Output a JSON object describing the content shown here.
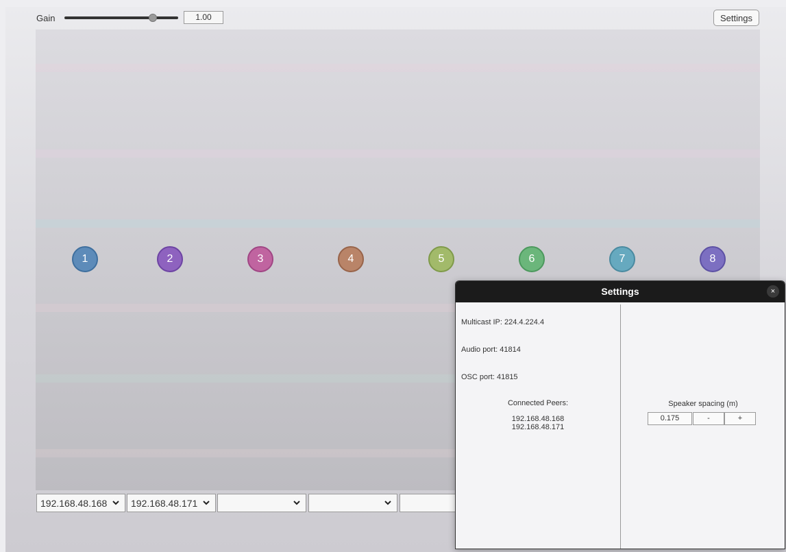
{
  "toolbar": {
    "gain_label": "Gain",
    "gain_value": "1.00",
    "gain_level": 0.78,
    "settings_label": "Settings"
  },
  "speakers": [
    {
      "label": "1",
      "color": "#5d8bb9",
      "border": "#3f6f9e"
    },
    {
      "label": "2",
      "color": "#8e62bf",
      "border": "#6d44a3"
    },
    {
      "label": "3",
      "color": "#c064a0",
      "border": "#a04684"
    },
    {
      "label": "4",
      "color": "#b98468",
      "border": "#98644a"
    },
    {
      "label": "5",
      "color": "#a2ba6a",
      "border": "#7f9a4a"
    },
    {
      "label": "6",
      "color": "#6bb67b",
      "border": "#4c985d"
    },
    {
      "label": "7",
      "color": "#66a9bf",
      "border": "#4a8aa0"
    },
    {
      "label": "8",
      "color": "#7c6fc1",
      "border": "#5d51a4"
    }
  ],
  "peer_selects": [
    {
      "value": "192.168.48.168"
    },
    {
      "value": "192.168.48.171"
    },
    {
      "value": ""
    },
    {
      "value": ""
    },
    {
      "value": ""
    }
  ],
  "dialog": {
    "title": "Settings",
    "close_symbol": "×",
    "multicast_ip": "Multicast IP: 224.4.224.4",
    "audio_port": "Audio port: 41814",
    "osc_port": "OSC port: 41815",
    "connected_peers_label": "Connected Peers:",
    "connected_peers": [
      "192.168.48.168",
      "192.168.48.171"
    ],
    "speaker_spacing_label": "Speaker spacing (m)",
    "speaker_spacing_value": "0.175",
    "minus_label": "-",
    "plus_label": "+"
  }
}
